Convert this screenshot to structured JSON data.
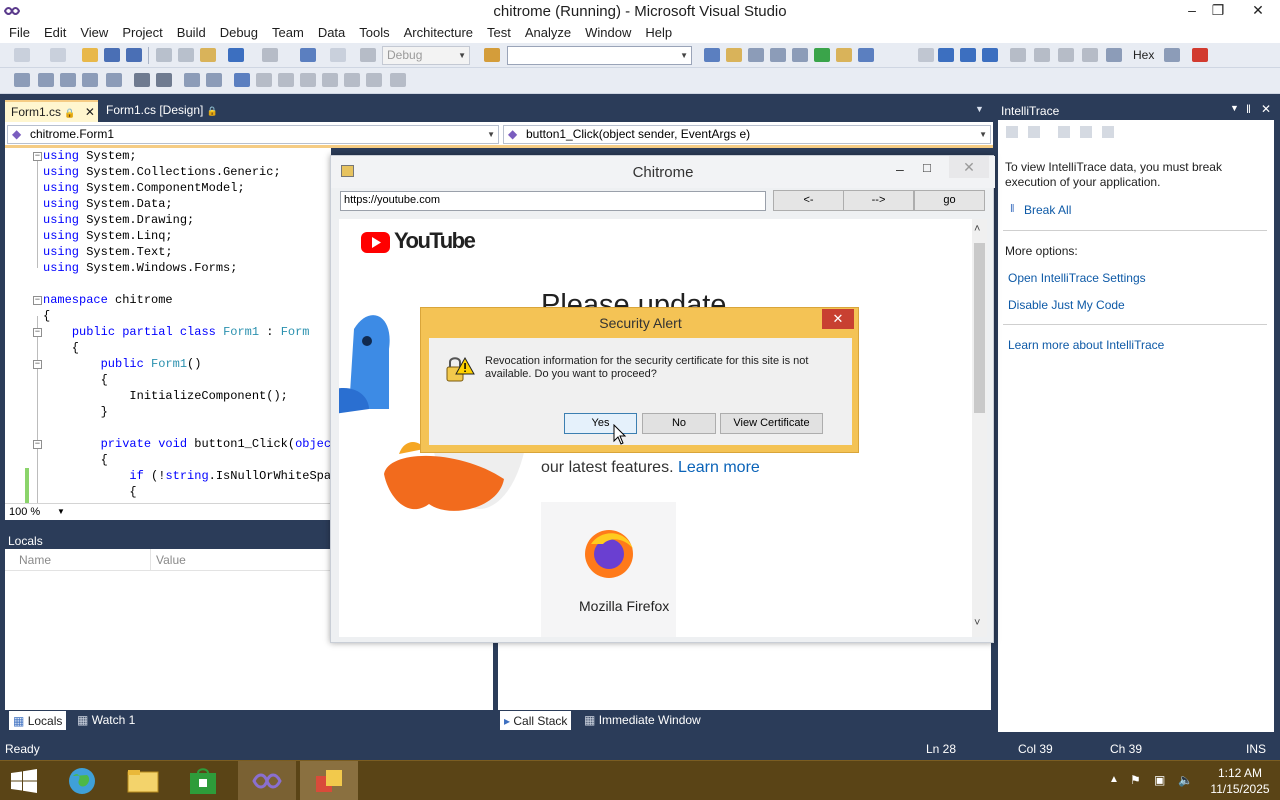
{
  "window": {
    "title": "chitrome (Running) - Microsoft Visual Studio"
  },
  "menu": [
    "File",
    "Edit",
    "View",
    "Project",
    "Build",
    "Debug",
    "Team",
    "Data",
    "Tools",
    "Architecture",
    "Test",
    "Analyze",
    "Window",
    "Help"
  ],
  "toolbar": {
    "config": "Debug",
    "hex_label": "Hex"
  },
  "editor": {
    "tabs": [
      {
        "label": "Form1.cs"
      },
      {
        "label": "Form1.cs [Design]"
      }
    ],
    "nav_class": "chitrome.Form1",
    "nav_method": "button1_Click(object sender, EventArgs e)",
    "zoom": "100 %",
    "code": [
      "using System;",
      "using System.Collections.Generic;",
      "using System.ComponentModel;",
      "using System.Data;",
      "using System.Drawing;",
      "using System.Linq;",
      "using System.Text;",
      "using System.Windows.Forms;",
      "",
      "namespace chitrome",
      "{",
      "    public partial class Form1 : Form",
      "    {",
      "        public Form1()",
      "        {",
      "            InitializeComponent();",
      "        }",
      "",
      "        private void button1_Click(object",
      "        {",
      "            if (!string.IsNullOrWhiteSpac",
      "            {"
    ]
  },
  "locals": {
    "title": "Locals",
    "col_name": "Name",
    "col_value": "Value"
  },
  "bottom_tabs_left": [
    "Locals",
    "Watch 1"
  ],
  "bottom_tabs_right": [
    "Call Stack",
    "Immediate Window"
  ],
  "intellitrace": {
    "title": "IntelliTrace",
    "message": "To view IntelliTrace data, you must break execution of your application.",
    "break_all": "Break All",
    "more_options": "More options:",
    "open_settings": "Open IntelliTrace Settings",
    "disable_jmc": "Disable Just My Code",
    "learn_more": "Learn more about IntelliTrace"
  },
  "status": {
    "ready": "Ready",
    "ln": "Ln 28",
    "col": "Col 39",
    "ch": "Ch 39",
    "mode": "INS"
  },
  "taskbar": {
    "time": "1:12 AM",
    "date": "11/15/2025"
  },
  "chitrome": {
    "title": "Chitrome",
    "url": "https://youtube.com",
    "back": "<-",
    "forward": "-->",
    "go": "go",
    "yt_logo": "YouTube",
    "headline": "Please update",
    "subline_prefix": "our latest features.",
    "subline_link": "Learn more",
    "browser_label": "Mozilla Firefox"
  },
  "alert": {
    "title": "Security Alert",
    "message": "Revocation information for the security certificate for this site is not available. Do you want to proceed?",
    "yes": "Yes",
    "no": "No",
    "view_cert": "View Certificate"
  }
}
